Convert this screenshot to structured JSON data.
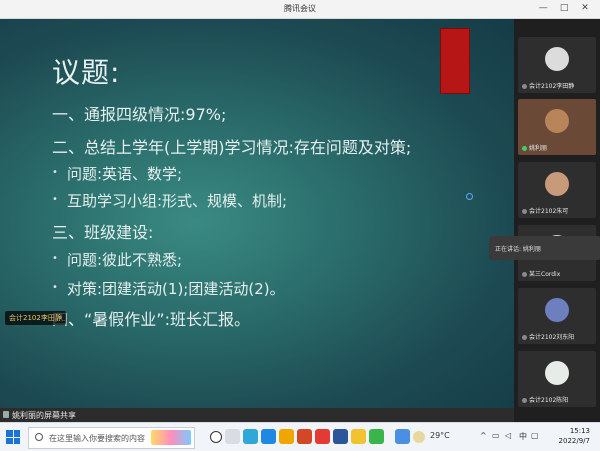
{
  "window": {
    "title": "腾讯会议",
    "controls": [
      "—",
      "□",
      "✕"
    ]
  },
  "slide": {
    "title": "议题:",
    "lines": [
      {
        "text": "一、通报四级情况:97%;",
        "level": 1
      },
      {
        "text": "二、总结上学年(上学期)学习情况:存在问题及对策;",
        "level": 1
      },
      {
        "text": "问题:英语、数学;",
        "level": 2
      },
      {
        "text": "互助学习小组:形式、规模、机制;",
        "level": 2
      },
      {
        "text": "三、班级建设:",
        "level": 1
      },
      {
        "text": "问题:彼此不熟悉;",
        "level": 2
      },
      {
        "text": "对策:团建活动(1);团建活动(2)。",
        "level": 2
      },
      {
        "text": "四、“暑假作业”:班长汇报。",
        "level": 1
      }
    ],
    "speaker_chip": "会计2102李田静"
  },
  "share_bar": {
    "label": "姚利丽的屏幕共享"
  },
  "participants": [
    {
      "name": "会计2102李田静",
      "color": "#dcdcdc"
    },
    {
      "name": "姚利丽",
      "color": "#b8845a"
    },
    {
      "name": "会计2102朱可",
      "color": "#c79a7a"
    },
    {
      "name": "某三Cordix",
      "color": "#d4d8c0"
    },
    {
      "name": "会计2102刘东阳",
      "color": "#6e7fc0"
    },
    {
      "name": "会计2102陈阳",
      "color": "#e6ece8"
    }
  ],
  "speaking": {
    "text": "正在讲话: 姚利丽"
  },
  "taskbar": {
    "search_placeholder": "在这里输入你要搜索的内容",
    "weather": "29°C",
    "ime": "中",
    "time": "15:13",
    "date": "2022/9/7"
  }
}
